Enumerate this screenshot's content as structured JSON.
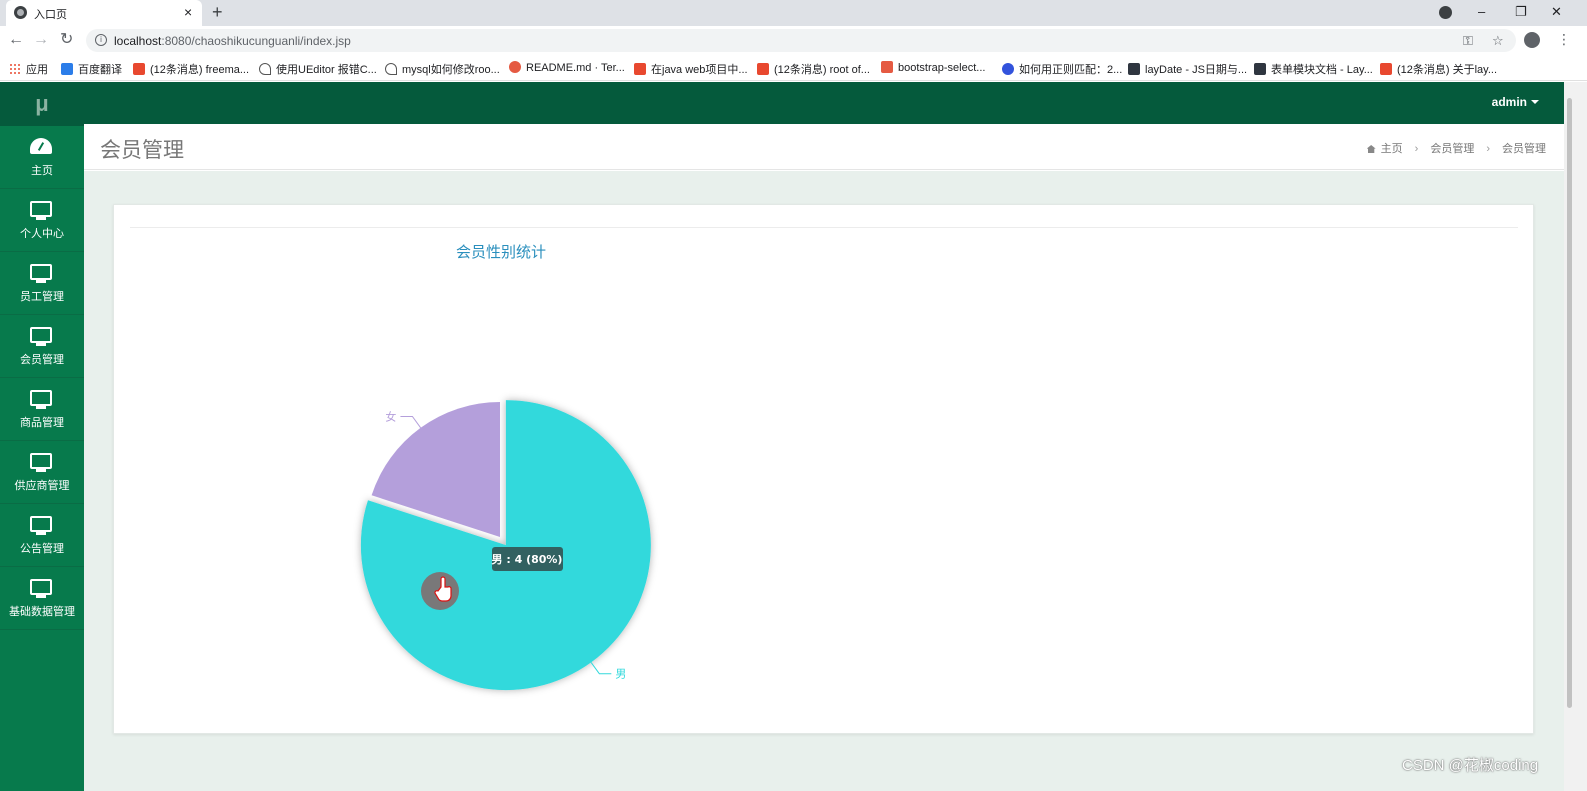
{
  "browser": {
    "tab_title": "入口页",
    "tab_close": "×",
    "new_tab": "+",
    "url_host": "localhost",
    "url_rest": ":8080/chaoshikucunguanli/index.jsp",
    "controls": {
      "minimize": "–",
      "restore": "❐",
      "close": "✕"
    },
    "nav": {
      "back": "←",
      "forward": "→",
      "reload": "↻"
    },
    "omni_icons": {
      "key": "⚿",
      "star": "☆"
    },
    "kebab": "⋮"
  },
  "bookmarks": [
    {
      "label": "应用",
      "icon": "apps-icon"
    },
    {
      "label": "百度翻译",
      "icon": "baidu-translate-icon"
    },
    {
      "label": "(12条消息) freema...",
      "icon": "csdn-icon"
    },
    {
      "label": "使用UEditor 报错C...",
      "icon": "bookmark-icon"
    },
    {
      "label": "mysql如何修改roo...",
      "icon": "bookmark-icon"
    },
    {
      "label": "README.md · Ter...",
      "icon": "gitee-icon"
    },
    {
      "label": "在java web项目中...",
      "icon": "csdn-icon"
    },
    {
      "label": "(12条消息) root of...",
      "icon": "csdn-icon"
    },
    {
      "label": "bootstrap-select...",
      "icon": "jianshu-icon"
    },
    {
      "label": "如何用正则匹配：2...",
      "icon": "baidu-icon"
    },
    {
      "label": "layDate - JS日期与...",
      "icon": "layui-icon"
    },
    {
      "label": "表单模块文档 - Lay...",
      "icon": "layui-icon"
    },
    {
      "label": "(12条消息) 关于lay...",
      "icon": "csdn-icon"
    }
  ],
  "app": {
    "logo": "μ",
    "user": "admin",
    "sidebar": [
      {
        "label": "主页",
        "icon": "dashboard-icon"
      },
      {
        "label": "个人中心",
        "icon": "monitor-icon"
      },
      {
        "label": "员工管理",
        "icon": "monitor-icon"
      },
      {
        "label": "会员管理",
        "icon": "monitor-icon"
      },
      {
        "label": "商品管理",
        "icon": "monitor-icon"
      },
      {
        "label": "供应商管理",
        "icon": "monitor-icon"
      },
      {
        "label": "公告管理",
        "icon": "monitor-icon"
      },
      {
        "label": "基础数据管理",
        "icon": "monitor-icon"
      }
    ],
    "page_title": "会员管理",
    "breadcrumb": [
      "主页",
      "会员管理",
      "会员管理"
    ],
    "breadcrumb_sep": "›"
  },
  "chart_data": {
    "type": "pie",
    "title": "会员性别统计",
    "categories": [
      "男",
      "女"
    ],
    "values": [
      4,
      1
    ],
    "colors": [
      "#33d9dc",
      "#b49fdb"
    ],
    "highlighted": "男",
    "tooltip": "男 : 4 (80%)"
  },
  "watermark": "CSDN @花椒coding"
}
